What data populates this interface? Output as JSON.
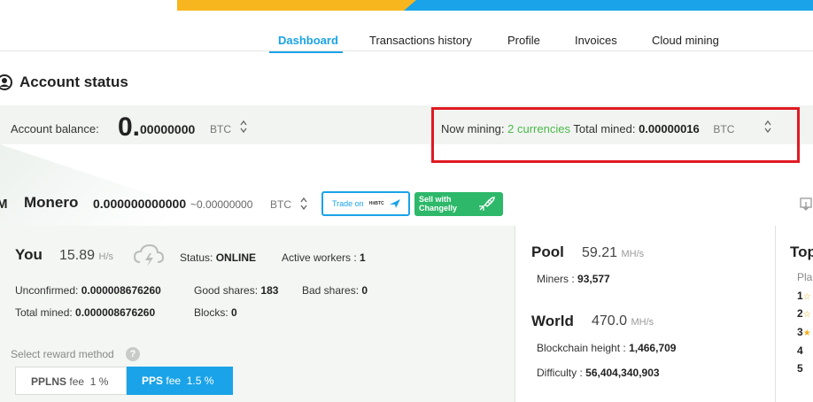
{
  "banner": {
    "colors": {
      "yellow": "#f7b51e",
      "blue": "#1aa3e8"
    }
  },
  "nav": {
    "tabs": [
      {
        "label": "Dashboard",
        "active": true
      },
      {
        "label": "Transactions history"
      },
      {
        "label": "Profile"
      },
      {
        "label": "Invoices"
      },
      {
        "label": "Cloud mining"
      }
    ]
  },
  "account": {
    "title": "Account status",
    "balance_label": "Account balance:",
    "balance_int": "0.",
    "balance_dec": "00000000",
    "balance_currency": "BTC",
    "now_mining_label": "Now mining:",
    "now_mining_value": "2 currencies",
    "total_mined_label": "Total mined:",
    "total_mined_value": "0.00000016",
    "total_mined_currency": "BTC",
    "highlight_color": "#e01a22"
  },
  "monero": {
    "name": "Monero",
    "balance": "0.000000000000",
    "approx": "~0.00000000",
    "currency": "BTC",
    "trade_label": "Trade on",
    "trade_logo": "HitBTC",
    "sell_label_1": "Sell with",
    "sell_label_2": "Changelly"
  },
  "you": {
    "title": "You",
    "rate": "15.89",
    "rate_unit": "H/s",
    "status_label": "Status:",
    "status_value": "ONLINE",
    "workers_label": "Active workers :",
    "workers_value": "1",
    "unconfirmed_label": "Unconfirmed:",
    "unconfirmed_value": "0.000008676260",
    "good_label": "Good shares:",
    "good_value": "183",
    "bad_label": "Bad shares:",
    "bad_value": "0",
    "total_label": "Total mined:",
    "total_value": "0.000008676260",
    "blocks_label": "Blocks:",
    "blocks_value": "0",
    "reward_label": "Select reward method",
    "help": "?",
    "pplns_name": "PPLNS",
    "pplns_fee_label": "fee",
    "pplns_fee": "1 %",
    "pps_name": "PPS",
    "pps_fee_label": "fee",
    "pps_fee": "1.5 %"
  },
  "pool": {
    "title": "Pool",
    "rate": "59.21",
    "rate_unit": "MH/s",
    "miners_label": "Miners :",
    "miners_value": "93,577"
  },
  "world": {
    "title": "World",
    "rate": "470.0",
    "rate_unit": "MH/s",
    "height_label": "Blockchain height :",
    "height_value": "1,466,709",
    "difficulty_label": "Difficulty :",
    "difficulty_value": "56,404,340,903"
  },
  "top": {
    "title": "Top",
    "sub": "Pla",
    "ranks": [
      "1",
      "2",
      "3",
      "4",
      "5"
    ]
  }
}
